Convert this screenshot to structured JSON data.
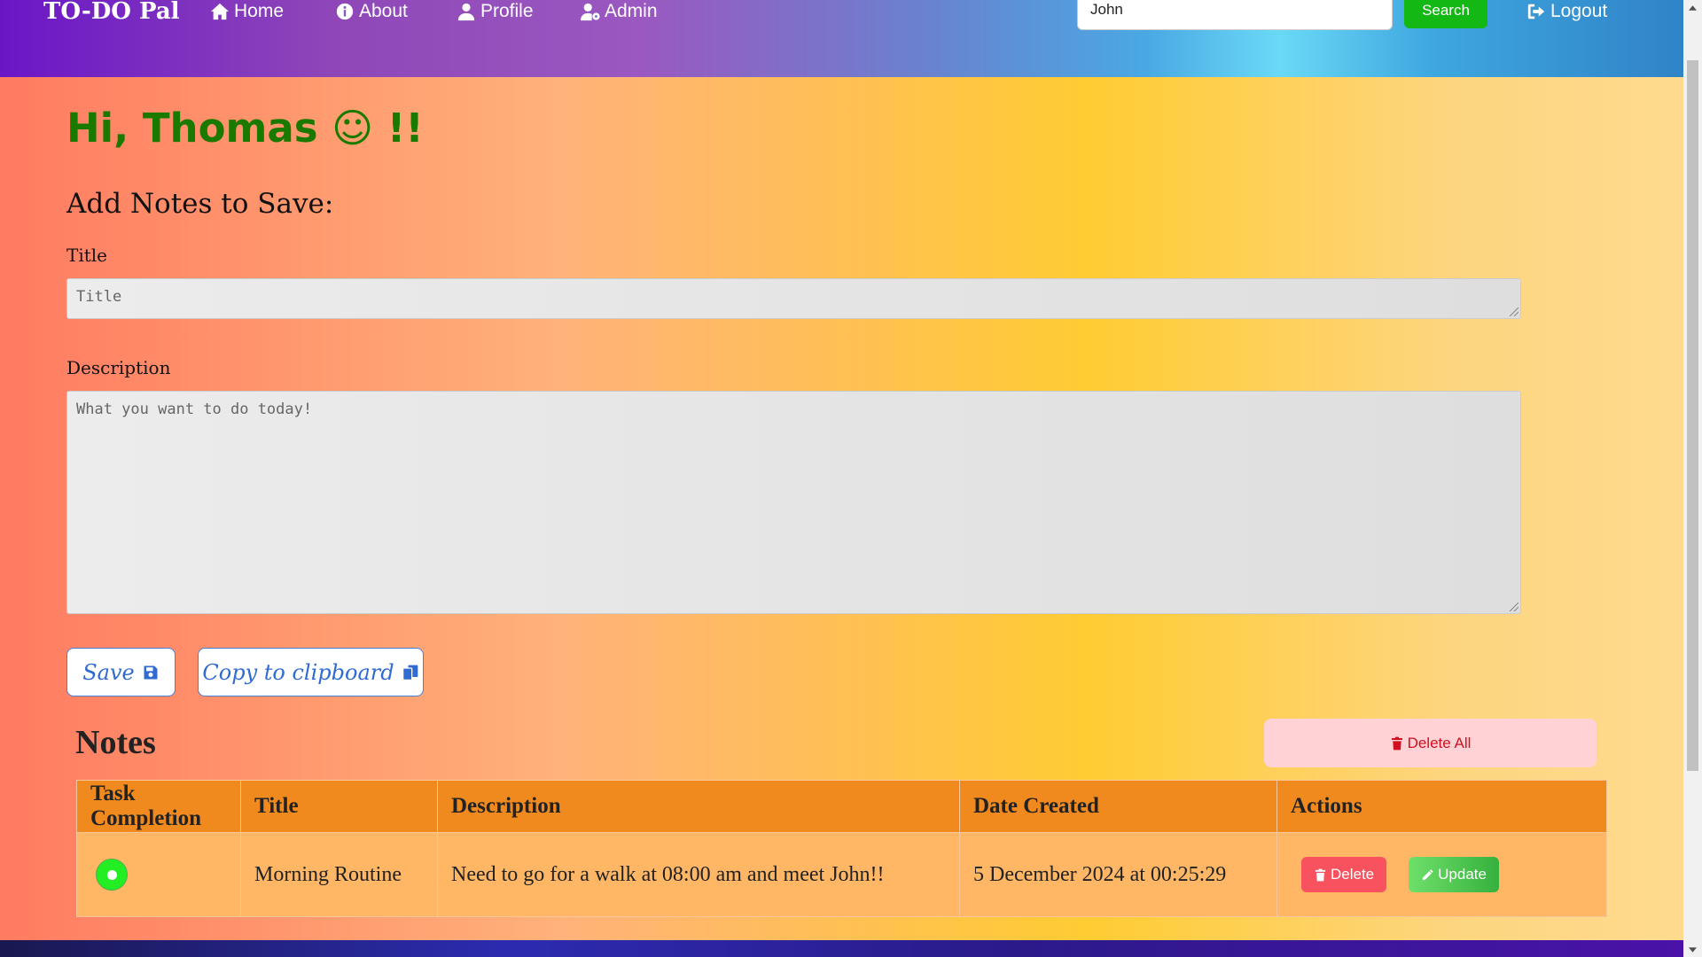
{
  "navbar": {
    "brand": "TO-DO Pal",
    "links": [
      {
        "label": "Home",
        "icon": "home-icon"
      },
      {
        "label": "About",
        "icon": "info-icon"
      },
      {
        "label": "Profile",
        "icon": "user-icon"
      },
      {
        "label": "Admin",
        "icon": "user-gear-icon"
      }
    ],
    "search_value": "John",
    "search_button": "Search",
    "logout": "Logout"
  },
  "greeting": "Hi, Thomas ☺ !!",
  "form": {
    "heading": "Add Notes to Save:",
    "title_label": "Title",
    "title_placeholder": "Title",
    "description_label": "Description",
    "description_placeholder": "What you want to do today!",
    "save_label": "Save",
    "copy_label": "Copy to clipboard"
  },
  "notes": {
    "heading": "Notes",
    "delete_all": "Delete All",
    "columns": [
      "Task Completion",
      "Title",
      "Description",
      "Date Created",
      "Actions"
    ],
    "rows": [
      {
        "completed": true,
        "title": "Morning Routine",
        "description": "Need to go for a walk at 08:00 am and meet John!!",
        "date_created": "5 December 2024 at 00:25:29",
        "delete_label": "Delete",
        "update_label": "Update"
      }
    ]
  },
  "colors": {
    "greeting": "#1a7a00",
    "search_button": "#14b814",
    "delete_button": "#f7525e",
    "update_button": "#36b13d",
    "table_header": "#f08a1e",
    "table_row": "#ffb766"
  }
}
